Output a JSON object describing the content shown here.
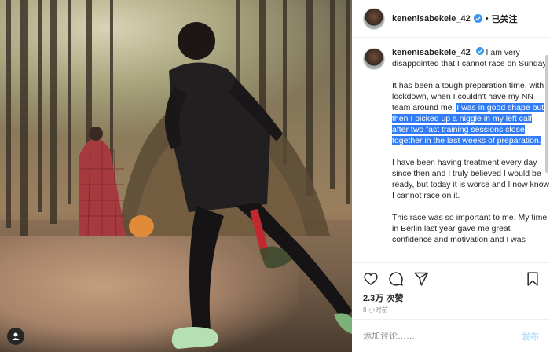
{
  "post": {
    "username": "kenenisabekele_42",
    "dot": "•",
    "follow_status": "已关注"
  },
  "caption": {
    "username": "kenenisabekele_42",
    "p1": "I am very disappointed that I cannot race on Sunday.",
    "p2_plain": "It has been a tough preparation time, with lockdown, when I couldn't have my NN team around me. ",
    "p2_highlight": "I was in good shape but then I picked up a niggle in my left calf after two fast training sessions close together in the last weeks of preparation.",
    "p3": "I have been having treatment every day since then and I truly believed I would be ready, but today it is worse and I now know I cannot race on it.",
    "p4": "This race was so important to me. My time in Berlin last year gave me great confidence and motivation and I was"
  },
  "stats": {
    "likes": "2.3万 次赞",
    "time": "8 小时前"
  },
  "comment": {
    "placeholder": "添加评论……",
    "post_label": "发布"
  },
  "colors": {
    "highlight": "#2f7cf6",
    "verified": "#3897f0",
    "post_disabled": "#b2dffc"
  }
}
